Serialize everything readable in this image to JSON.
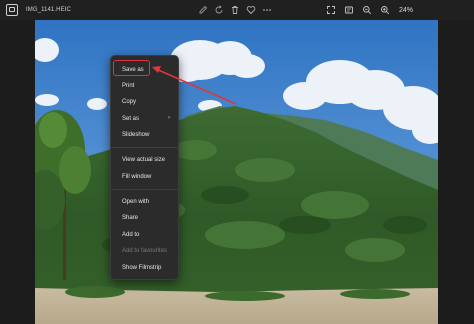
{
  "window": {
    "title": "IMG_1141.HEIC",
    "zoom": "24%"
  },
  "toolbar": {
    "left_icons": [
      "edit-icon",
      "rotate-icon",
      "delete-icon",
      "favorite-icon",
      "more-icon"
    ],
    "right_icons": [
      "fullscreen-icon",
      "info-icon",
      "zoom-out-icon",
      "zoom-in-icon"
    ]
  },
  "context_menu": {
    "items": [
      {
        "label": "Save as",
        "highlighted": true
      },
      {
        "label": "Print"
      },
      {
        "label": "Copy"
      },
      {
        "label": "Set as",
        "submenu": true
      },
      {
        "label": "Slideshow"
      },
      {
        "label": "View actual size"
      },
      {
        "label": "Fill window"
      },
      {
        "label": "Open with"
      },
      {
        "label": "Share"
      },
      {
        "label": "Add to"
      },
      {
        "label": "Add to favourites",
        "disabled": true
      },
      {
        "label": "Show Filmstrip"
      }
    ]
  },
  "colors": {
    "highlight": "#e0353b",
    "menu_bg": "#2b2b2b",
    "window_bg": "#1c1c1c"
  }
}
